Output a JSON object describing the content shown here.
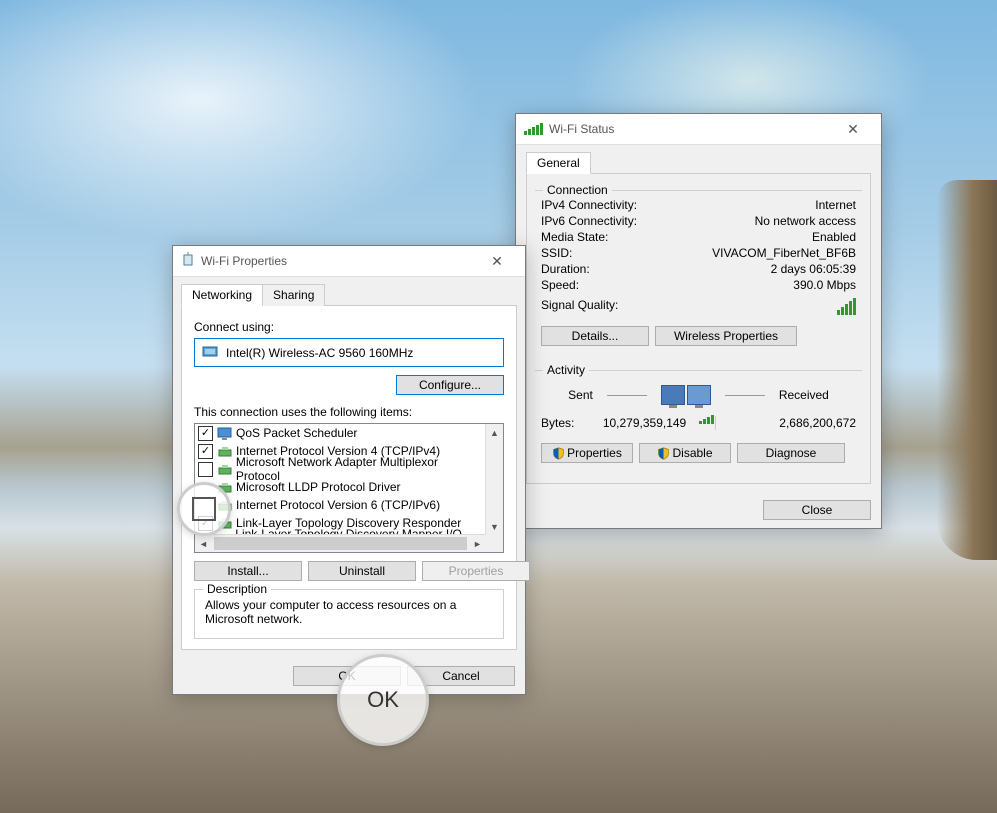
{
  "status_window": {
    "title": "Wi-Fi Status",
    "tab_general": "General",
    "section_connection": "Connection",
    "ipv4_label": "IPv4 Connectivity:",
    "ipv4_value": "Internet",
    "ipv6_label": "IPv6 Connectivity:",
    "ipv6_value": "No network access",
    "media_label": "Media State:",
    "media_value": "Enabled",
    "ssid_label": "SSID:",
    "ssid_value": "VIVACOM_FiberNet_BF6B",
    "duration_label": "Duration:",
    "duration_value": "2 days 06:05:39",
    "speed_label": "Speed:",
    "speed_value": "390.0 Mbps",
    "signal_label": "Signal Quality:",
    "btn_details": "Details...",
    "btn_wireless": "Wireless Properties",
    "section_activity": "Activity",
    "sent_label": "Sent",
    "received_label": "Received",
    "bytes_label": "Bytes:",
    "bytes_sent": "10,279,359,149",
    "bytes_recv": "2,686,200,672",
    "btn_properties": "Properties",
    "btn_disable": "Disable",
    "btn_diagnose": "Diagnose",
    "btn_close": "Close"
  },
  "props_window": {
    "title": "Wi-Fi Properties",
    "tab_networking": "Networking",
    "tab_sharing": "Sharing",
    "connect_using": "Connect using:",
    "adapter": "Intel(R) Wireless-AC 9560 160MHz",
    "btn_configure": "Configure...",
    "items_label": "This connection uses the following items:",
    "items": [
      {
        "checked": true,
        "icon": "monitor",
        "label": "QoS Packet Scheduler"
      },
      {
        "checked": true,
        "icon": "net",
        "label": "Internet Protocol Version 4 (TCP/IPv4)"
      },
      {
        "checked": false,
        "icon": "net",
        "label": "Microsoft Network Adapter Multiplexor Protocol"
      },
      {
        "checked": false,
        "icon": "net",
        "label": "Microsoft LLDP Protocol Driver",
        "hide_checkbox": true
      },
      {
        "checked": false,
        "icon": "net",
        "label": "Internet Protocol Version 6 (TCP/IPv6)",
        "hide_checkbox": true
      },
      {
        "checked": true,
        "icon": "net",
        "label": "Link-Layer Topology Discovery Responder"
      },
      {
        "checked": true,
        "icon": "net",
        "label": "Link-Layer Topology Discovery Mapper I/O Driver"
      }
    ],
    "btn_install": "Install...",
    "btn_uninstall": "Uninstall",
    "btn_props": "Properties",
    "desc_title": "Description",
    "desc_text": "Allows your computer to access resources on a Microsoft network.",
    "btn_ok": "OK",
    "btn_cancel": "Cancel"
  }
}
